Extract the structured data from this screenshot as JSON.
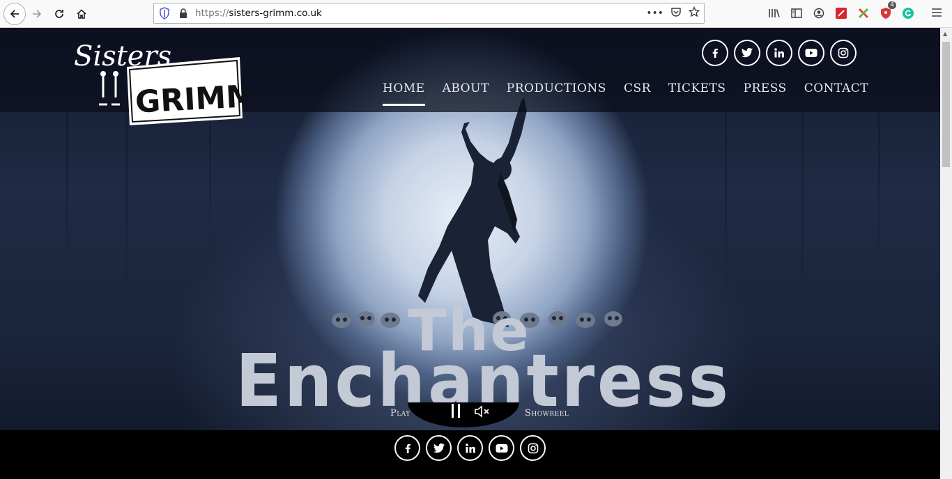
{
  "browser": {
    "url_scheme": "https://",
    "url_host": "sisters-grimm.co.uk",
    "extension_badge": "4"
  },
  "site": {
    "logo_top": "Sisters",
    "logo_bottom": "GRIMM",
    "nav": [
      {
        "label": "HOME",
        "active": true
      },
      {
        "label": "ABOUT",
        "active": false
      },
      {
        "label": "PRODUCTIONS",
        "active": false
      },
      {
        "label": "CSR",
        "active": false
      },
      {
        "label": "TICKETS",
        "active": false
      },
      {
        "label": "PRESS",
        "active": false
      },
      {
        "label": "CONTACT",
        "active": false
      }
    ],
    "social": [
      "facebook-icon",
      "twitter-icon",
      "linkedin-icon",
      "youtube-icon",
      "instagram-icon"
    ]
  },
  "hero": {
    "title_line1": "The",
    "title_line2": "Enchantress"
  },
  "controls": {
    "play_label": "Play",
    "showreel_label": "Showreel"
  },
  "colors": {
    "header_band": "#0a0c1a",
    "title_text": "#c3cad6",
    "nav_text": "#e8e8ee"
  }
}
